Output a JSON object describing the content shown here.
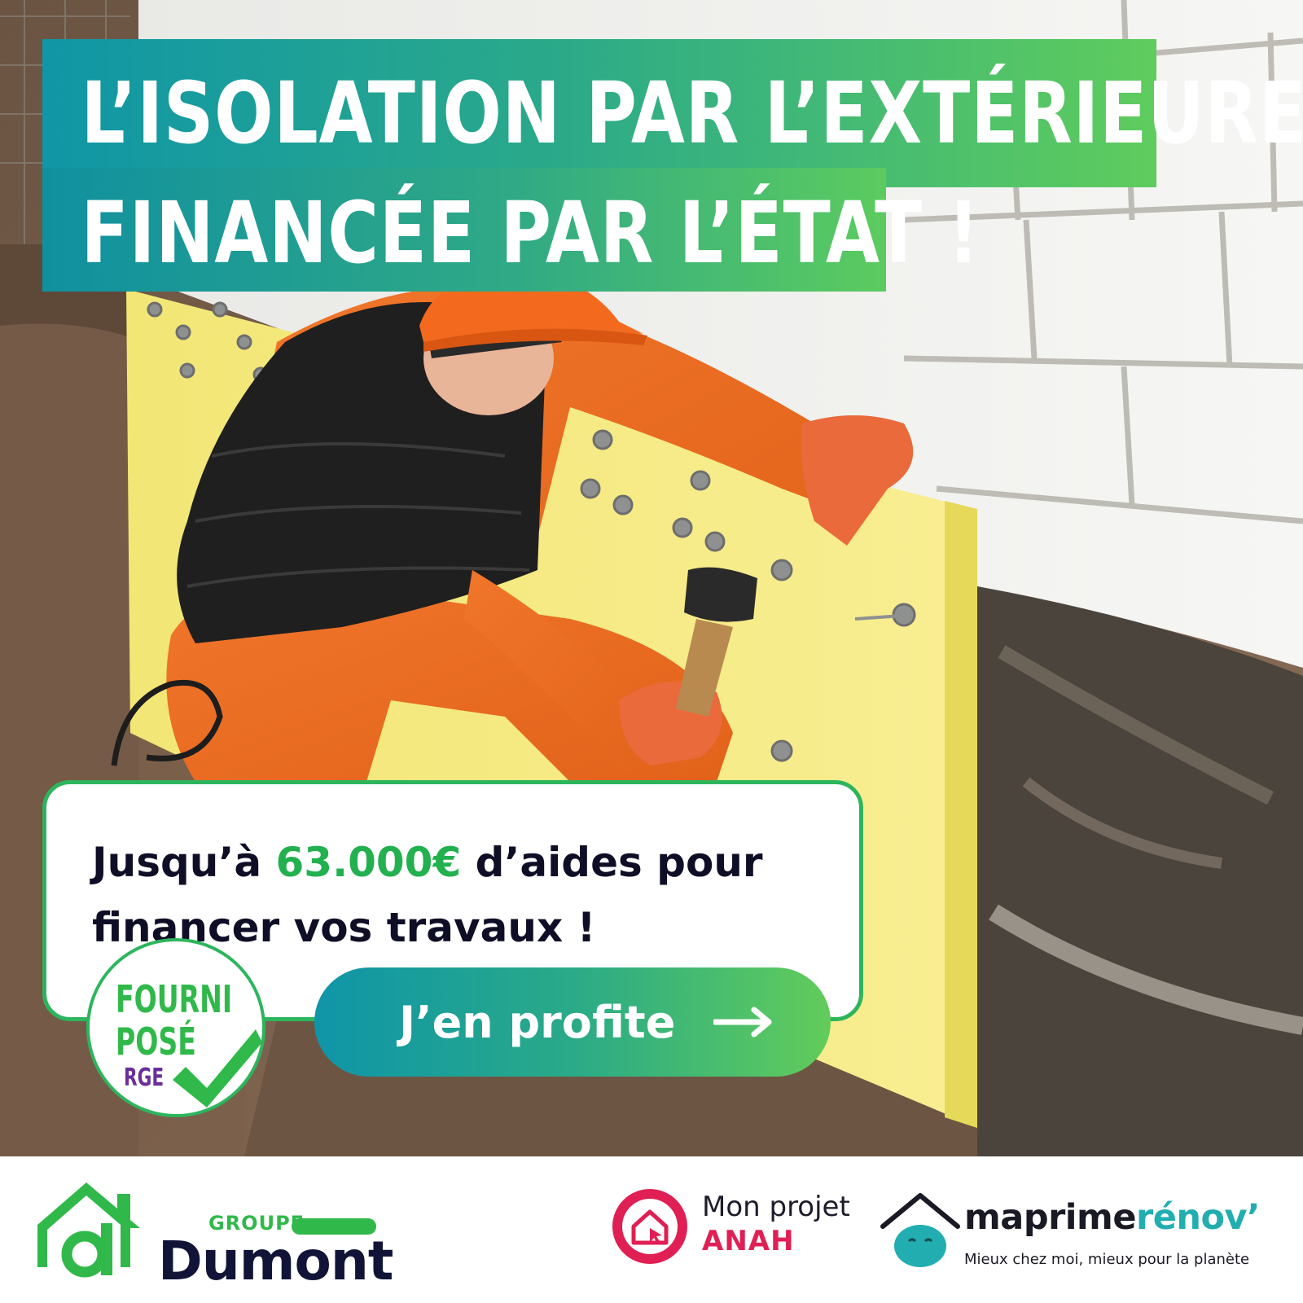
{
  "headline": {
    "line1": "L’ISOLATION PAR L’EXTÉRIEURE",
    "line2": "FINANCÉE PAR L’ÉTAT !"
  },
  "offer": {
    "prefix": "Jusqu’à ",
    "amount": "63.000€",
    "suffix": " d’aides pour financer vos travaux !"
  },
  "cta": {
    "label": "J’en profite",
    "icon": "arrow-right-icon"
  },
  "badge": {
    "line1": "FOURNI",
    "line2": "POSÉ",
    "line3": "RGE",
    "icon": "checkmark-icon"
  },
  "footer": {
    "dumont": {
      "groupe": "GROUPE",
      "name": "Dumont"
    },
    "anah": {
      "line1": "Mon projet",
      "line2": "ANAH",
      "icon": "house-cursor-icon"
    },
    "maprimerenov": {
      "name_part1": "maprime",
      "name_part2": "rénov’",
      "tagline": "Mieux chez moi, mieux pour la planète",
      "icon": "house-roof-icon"
    }
  },
  "colors": {
    "brand_green": "#30b94a",
    "brand_teal": "#1096a6",
    "brand_navy": "#111437",
    "anah_pink": "#e01f54",
    "rge_purple": "#6a2f9a"
  }
}
